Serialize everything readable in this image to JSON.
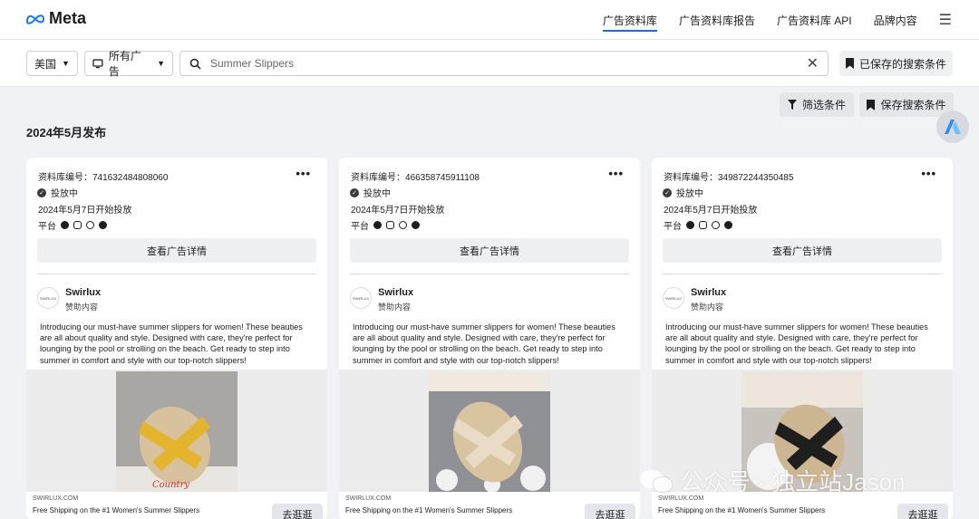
{
  "header": {
    "logo_text": "Meta",
    "nav": [
      "广告资料库",
      "广告资料库报告",
      "广告资料库 API",
      "品牌内容"
    ]
  },
  "search": {
    "country": "美国",
    "ad_category": "所有广告",
    "query": "Summer Slippers",
    "saved_label": "已保存的搜索条件"
  },
  "toolbar": {
    "filter_label": "筛选条件",
    "save_label": "保存搜索条件"
  },
  "section_title": "2024年5月发布",
  "cards": [
    {
      "library_id": "资料库编号：741632484808060",
      "status": "投放中",
      "start": "2024年5月7日开始投放",
      "platform_label": "平台",
      "details_button": "查看广告详情",
      "avatar_text": "SWIRLUX",
      "advertiser": "Swirlux",
      "sponsored": "赞助内容",
      "body": "Introducing our must-have summer slippers for women! These beauties are all about quality and style. Designed with care, they're perfect for lounging by the pool or strolling on the beach. Get ready to step into summer in comfort and style with our top-notch slippers!",
      "image_caption": "Country",
      "domain": "SWIRLUX.COM",
      "headline": "Free Shipping on the #1 Women's Summer Slippers",
      "cta": "去逛逛",
      "sandal_color": "#e3b52e"
    },
    {
      "library_id": "资料库编号：466358745911108",
      "status": "投放中",
      "start": "2024年5月7日开始投放",
      "platform_label": "平台",
      "details_button": "查看广告详情",
      "avatar_text": "SWIRLUX",
      "advertiser": "Swirlux",
      "sponsored": "赞助内容",
      "body": "Introducing our must-have summer slippers for women! These beauties are all about quality and style. Designed with care, they're perfect for lounging by the pool or strolling on the beach. Get ready to step into summer in comfort and style with our top-notch slippers!",
      "domain": "SWIRLUX.COM",
      "headline": "Free Shipping on the #1 Women's Summer Slippers",
      "cta": "去逛逛",
      "sandal_color": "#eadbc6"
    },
    {
      "library_id": "资料库编号：349872244350485",
      "status": "投放中",
      "start": "2024年5月7日开始投放",
      "platform_label": "平台",
      "details_button": "查看广告详情",
      "avatar_text": "SWIRLUX",
      "advertiser": "Swirlux",
      "sponsored": "赞助内容",
      "body": "Introducing our must-have summer slippers for women! These beauties are all about quality and style. Designed with care, they're perfect for lounging by the pool or strolling on the beach. Get ready to step into summer in comfort and style with our top-notch slippers!",
      "domain": "SWIRLUX.COM",
      "headline": "Free Shipping on the #1 Women's Summer Slippers",
      "cta": "去逛逛",
      "sandal_color": "#1e1e1e"
    }
  ],
  "watermark": "公众号 · 独立站Jason",
  "colors": {
    "accent": "#1c6fd8",
    "background": "#f0f2f5"
  }
}
